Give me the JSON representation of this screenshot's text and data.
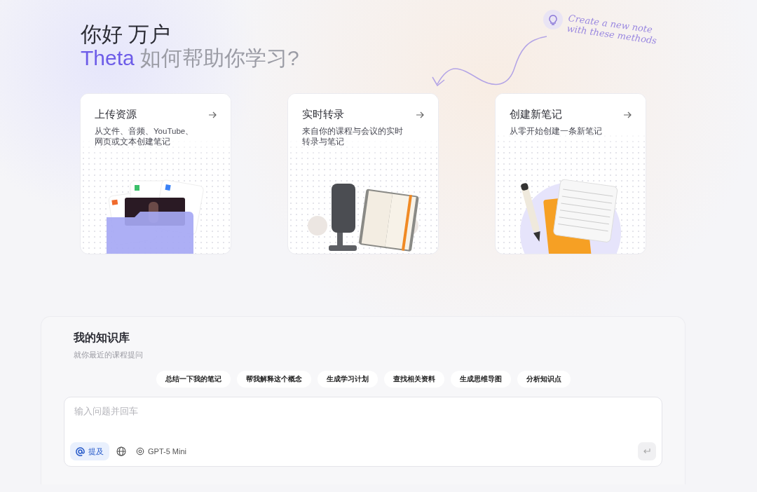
{
  "greeting": {
    "line1": "你好 万户",
    "brand": "Theta",
    "line2": "如何帮助你学习?"
  },
  "annotation": {
    "lines": [
      "Create a new note",
      "with these methods"
    ]
  },
  "cards": [
    {
      "kind": "upload",
      "title": "上传资源",
      "description": "从文件、音频、YouTube、网页或文本创建笔记"
    },
    {
      "kind": "transcribe",
      "title": "实时转录",
      "description": "来自你的课程与会议的实时转录与笔记"
    },
    {
      "kind": "note",
      "title": "创建新笔记",
      "description": "从零开始创建一条新笔记"
    }
  ],
  "knowledge": {
    "title": "我的知识库",
    "subtitle": "就你最近的课程提问",
    "suggestions": [
      "总结一下我的笔记",
      "帮我解释这个概念",
      "生成学习计划",
      "查找相关资料",
      "生成思维导图",
      "分析知识点"
    ],
    "input": {
      "placeholder": "输入问题并回车"
    },
    "mention": "提及",
    "model": "GPT-5 Mini"
  }
}
